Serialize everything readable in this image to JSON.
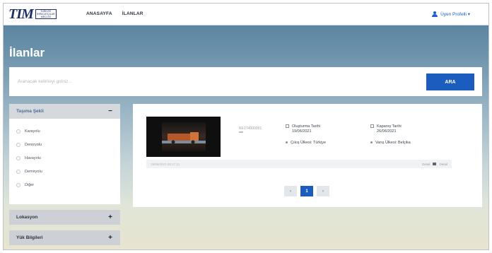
{
  "header": {
    "logo_mark": "TIM",
    "logo_sub": [
      "TÜRKİYE",
      "İHRACATÇILAR",
      "MECLİSİ"
    ],
    "nav": [
      "ANASAYFA",
      "İLANLAR"
    ],
    "profile_label": "Üyen Profelli ▾"
  },
  "page_title": "İlanlar",
  "search": {
    "placeholder": "Aranacak kelimeyi giriniz...",
    "button_label": "ARA"
  },
  "filters": [
    {
      "label": "Taşıma Şekli",
      "toggle": "−",
      "options": [
        "Karayolu",
        "Denizyolu",
        "Havayolu",
        "Demiryolu",
        "Diğer"
      ]
    },
    {
      "label": "Lokasyon",
      "toggle": "+"
    },
    {
      "label": "Yük Bilgileri",
      "toggle": "+"
    }
  ],
  "listing": {
    "code": "RE1T4000001",
    "stars": "***",
    "created_label": "Oluşturma Tarihi",
    "created_date": "19/06/2021",
    "closing_label": "Kapanış Tarihi",
    "closing_date": "26/06/2021",
    "origin": "Çıkış Ülkesi: Türkiye",
    "destination": "Varış Ülkesi: Belçika",
    "timestamp": "19/06/2021 09:17:12",
    "footer_left": "Detail",
    "footer_right": "Detail"
  },
  "pagination": [
    "‹",
    "1",
    "›"
  ],
  "colors": {
    "accent": "#1a5dbf",
    "logo": "#1c2f6b"
  }
}
